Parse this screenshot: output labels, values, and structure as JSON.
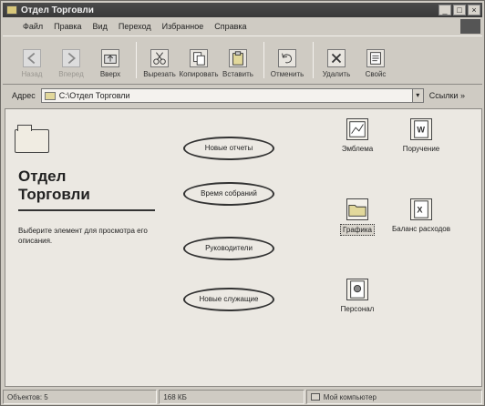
{
  "window": {
    "title": "Отдел Торговли",
    "controls": {
      "minimize": "_",
      "maximize": "□",
      "close": "×"
    }
  },
  "menu": [
    "Файл",
    "Правка",
    "Вид",
    "Переход",
    "Избранное",
    "Справка"
  ],
  "toolbar": {
    "buttons": [
      {
        "label": "Назад",
        "enabled": false,
        "icon": "back-icon"
      },
      {
        "label": "Вперед",
        "enabled": false,
        "icon": "forward-icon"
      },
      {
        "label": "Вверх",
        "enabled": true,
        "icon": "up-folder-icon"
      },
      {
        "label": "Вырезать",
        "enabled": true,
        "icon": "scissors-icon"
      },
      {
        "label": "Копировать",
        "enabled": true,
        "icon": "copy-icon"
      },
      {
        "label": "Вставить",
        "enabled": true,
        "icon": "paste-icon"
      },
      {
        "label": "Отменить",
        "enabled": true,
        "icon": "undo-icon"
      },
      {
        "label": "Удалить",
        "enabled": true,
        "icon": "delete-icon"
      },
      {
        "label": "Свойс",
        "enabled": true,
        "icon": "properties-icon"
      }
    ]
  },
  "address": {
    "label": "Адрес",
    "value": "C:\\Отдел Торговли",
    "links": "Ссылки »"
  },
  "left_pane": {
    "heading": "Отдел\nТорговли",
    "description": "Выберите элемент для просмотра его описания."
  },
  "middle": {
    "ovals": [
      "Новые отчеты",
      "Время собраний",
      "Руководители",
      "Новые служащие"
    ]
  },
  "files": [
    {
      "label": "Эмблема",
      "icon": "image-file-icon",
      "selected": false
    },
    {
      "label": "Поручение",
      "icon": "word-document-icon",
      "selected": false
    },
    {
      "label": "Графика",
      "icon": "folder-icon",
      "selected": true
    },
    {
      "label": "Баланс расходов",
      "icon": "excel-spreadsheet-icon",
      "selected": false
    },
    {
      "label": "Персонал",
      "icon": "database-file-icon",
      "selected": false
    }
  ],
  "status": {
    "objects": "Объектов: 5",
    "size": "168 КБ",
    "location": "Мой компьютер"
  }
}
